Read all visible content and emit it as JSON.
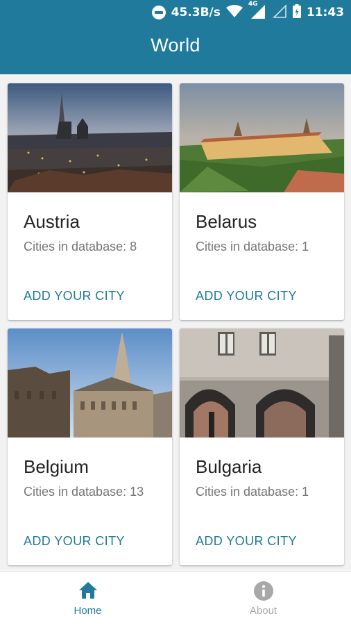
{
  "status_bar": {
    "speed": "45.3B/s",
    "network": "4G",
    "time": "11:43"
  },
  "appbar": {
    "title": "World"
  },
  "cards": [
    {
      "country": "Austria",
      "cities_label": "Cities in database: 8",
      "action": "ADD YOUR CITY",
      "image": "austria-city-skyline"
    },
    {
      "country": "Belarus",
      "cities_label": "Cities in database: 1",
      "action": "ADD YOUR CITY",
      "image": "belarus-castle"
    },
    {
      "country": "Belgium",
      "cities_label": "Cities in database: 13",
      "action": "ADD YOUR CITY",
      "image": "belgium-grand-place"
    },
    {
      "country": "Bulgaria",
      "cities_label": "Cities in database: 1",
      "action": "ADD YOUR CITY",
      "image": "bulgaria-arches"
    }
  ],
  "bottom_nav": {
    "home": {
      "label": "Home",
      "icon": "home-icon",
      "active": true
    },
    "about": {
      "label": "About",
      "icon": "info-icon",
      "active": false
    }
  },
  "colors": {
    "primary": "#1f7a9c",
    "inactive": "#a8a8a8"
  }
}
